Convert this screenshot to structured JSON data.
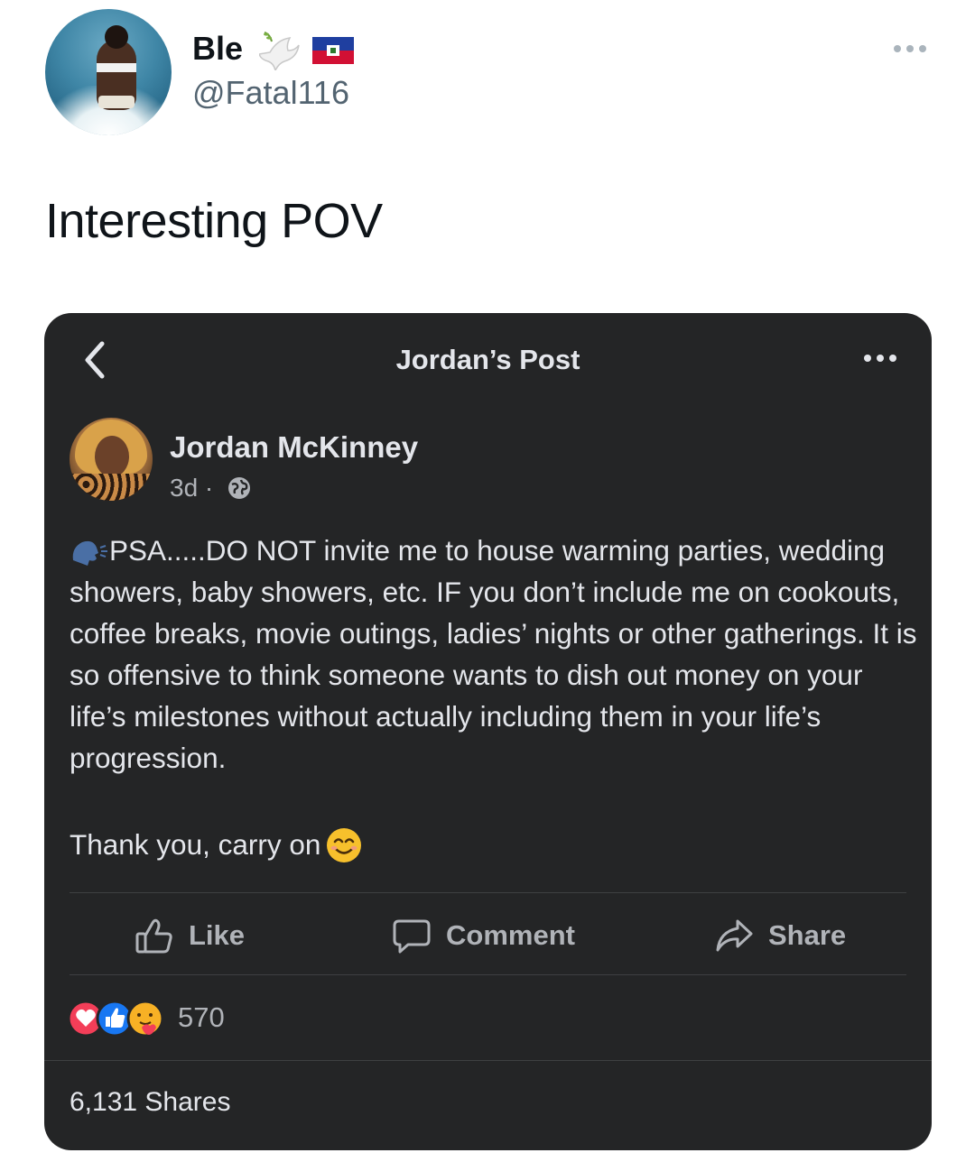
{
  "tweet": {
    "user_name": "Ble",
    "handle": "@Fatal116",
    "text": "Interesting POV",
    "icons": [
      "dove-icon",
      "haiti-flag-icon",
      "more-options-icon"
    ]
  },
  "fb_post": {
    "header_title": "Jordan’s Post",
    "author_name": "Jordan McKinney",
    "time": "3d ·",
    "body": "PSA.....DO NOT invite me to house warming parties, wedding showers, baby showers, etc. IF you don’t include me on cookouts, coffee breaks, movie outings, ladies’ nights or other gatherings. It is so offensive to think someone wants to dish out money on your life’s milestones without actually including them in your life’s progression.",
    "signoff": "Thank you, carry on",
    "actions": {
      "like": "Like",
      "comment": "Comment",
      "share": "Share"
    },
    "reaction_count": "570",
    "shares_text": "6,131 Shares",
    "colors": {
      "card_bg": "#242526",
      "text": "#e4e6eb",
      "muted": "#b0b3b8",
      "divider": "#3e4042"
    }
  }
}
